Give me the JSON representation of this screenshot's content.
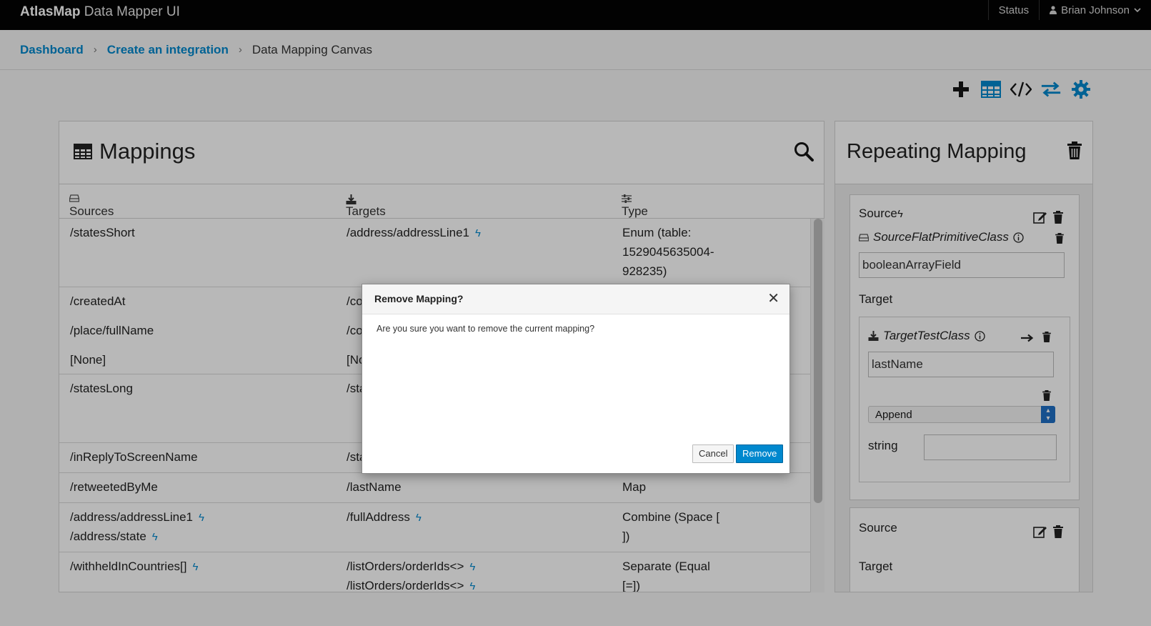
{
  "topbar": {
    "brand_bold": "AtlasMap",
    "brand_rest": " Data Mapper UI",
    "status": "Status",
    "user": "Brian Johnson"
  },
  "breadcrumb": {
    "items": [
      "Dashboard",
      "Create an integration"
    ],
    "current": "Data Mapping Canvas"
  },
  "toolbar": {
    "icons": [
      "plus-icon",
      "table-icon",
      "code-icon",
      "exchange-icon",
      "gear-icon"
    ],
    "accent": "#0088ce"
  },
  "mappings": {
    "title": "Mappings",
    "columns": {
      "sources": "Sources",
      "targets": "Targets",
      "type": "Type"
    },
    "rows": [
      {
        "sources": [
          "/statesShort"
        ],
        "targets": [
          "/address/addressLine1"
        ],
        "type": "Enum (table: 1529045635004-928235)"
      },
      {
        "sources": [
          "/createdAt",
          "/place/fullName",
          "[None]"
        ],
        "targets": [
          "/co",
          "/co",
          "[No"
        ],
        "type": ""
      },
      {
        "sources": [
          "/statesLong"
        ],
        "targets": [
          "/sta"
        ],
        "type": ""
      },
      {
        "sources": [
          "/inReplyToScreenName"
        ],
        "targets": [
          "/sta"
        ],
        "type": ""
      },
      {
        "sources": [
          "/retweetedByMe"
        ],
        "targets": [
          "/lastName"
        ],
        "type": "Map"
      },
      {
        "sources": [
          "/address/addressLine1",
          "/address/state"
        ],
        "targets": [
          "/fullAddress"
        ],
        "type": "Combine (Space [ ])"
      },
      {
        "sources": [
          "/withheldInCountries[]"
        ],
        "targets": [
          "/listOrders/orderIds<>",
          "/listOrders/orderIds<>"
        ],
        "type": "Separate (Equal [=])"
      }
    ]
  },
  "repeating": {
    "title": "Repeating Mapping",
    "source_label": "Source",
    "source_class": "SourceFlatPrimitiveClass",
    "source_field": "booleanArrayField",
    "target_label": "Target",
    "target_class": "TargetTestClass",
    "target_field": "lastName",
    "transformation": "Append",
    "param_label": "string",
    "param_value": "",
    "source2_label": "Source",
    "target2_label": "Target"
  },
  "modal": {
    "title": "Remove Mapping?",
    "message": "Are you sure you want to remove the current mapping?",
    "cancel": "Cancel",
    "remove": "Remove"
  }
}
